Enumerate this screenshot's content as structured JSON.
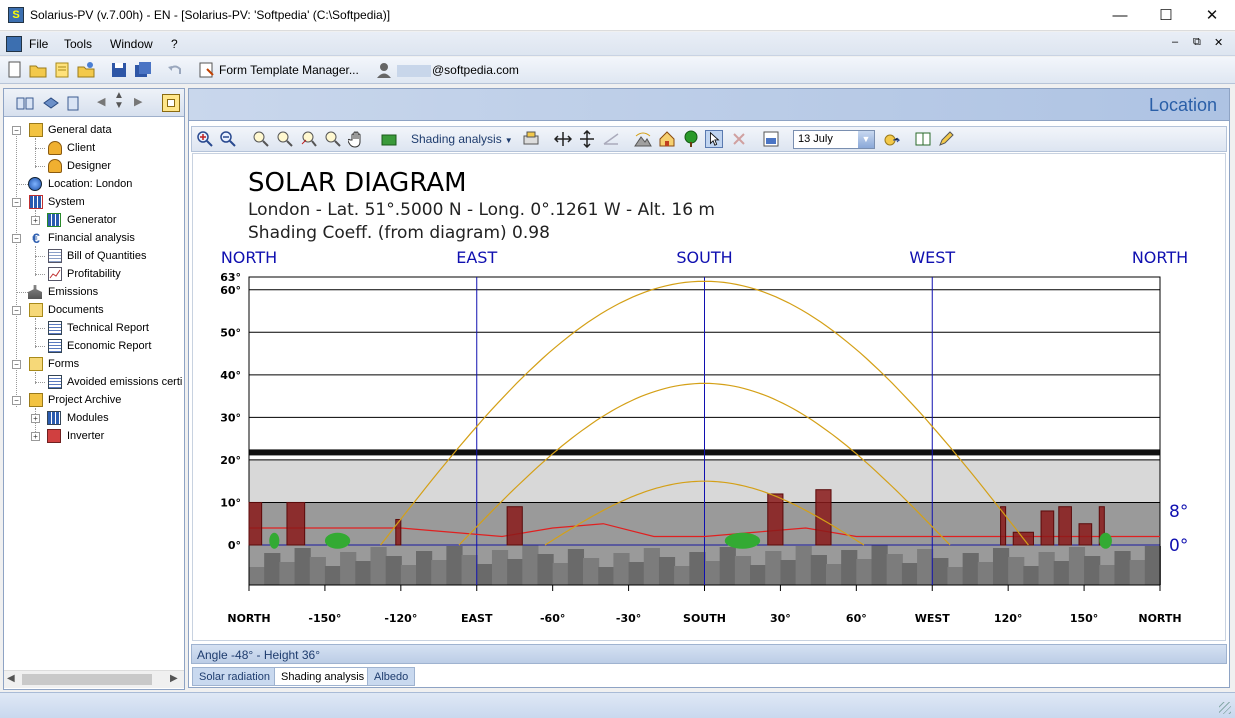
{
  "window": {
    "title": "Solarius-PV (v.7.00h) - EN - [Solarius-PV: 'Softpedia' (C:\\Softpedia)]",
    "minimize": "—",
    "maximize": "☐",
    "close": "✕"
  },
  "menu": {
    "items": [
      "File",
      "Tools",
      "Window",
      "?"
    ],
    "mdi_controls": [
      "–",
      "⧉",
      "✕"
    ]
  },
  "toolbar": {
    "form_template_manager": "Form Template Manager...",
    "user_email": "@softpedia.com"
  },
  "tree": {
    "items": [
      {
        "label": "General data"
      },
      {
        "label": "Client"
      },
      {
        "label": "Designer"
      },
      {
        "label": "Location: London"
      },
      {
        "label": "System"
      },
      {
        "label": "Generator"
      },
      {
        "label": "Financial analysis"
      },
      {
        "label": "Bill of Quantities"
      },
      {
        "label": "Profitability"
      },
      {
        "label": "Emissions"
      },
      {
        "label": "Documents"
      },
      {
        "label": "Technical Report"
      },
      {
        "label": "Economic Report"
      },
      {
        "label": "Forms"
      },
      {
        "label": "Avoided emissions certif"
      },
      {
        "label": "Project Archive"
      },
      {
        "label": "Modules"
      },
      {
        "label": "Inverter"
      }
    ]
  },
  "location_header": "Location",
  "chart_toolbar": {
    "shading_dropdown": "Shading analysis",
    "date": "13 July"
  },
  "chart_data": {
    "type": "line",
    "title": "SOLAR DIAGRAM",
    "subtitle": "London - Lat. 51°.5000 N - Long. 0°.1261 W - Alt. 16 m",
    "shading": "Shading Coeff. (from diagram) 0.98",
    "direction_labels": [
      "NORTH",
      "EAST",
      "SOUTH",
      "WEST",
      "NORTH"
    ],
    "x_ticks": [
      "NORTH",
      "-150°",
      "-120°",
      "EAST",
      "-60°",
      "-30°",
      "SOUTH",
      "30°",
      "60°",
      "WEST",
      "120°",
      "150°",
      "NORTH"
    ],
    "x_tick_values": [
      -180,
      -150,
      -120,
      -90,
      -60,
      -30,
      0,
      30,
      60,
      90,
      120,
      150,
      180
    ],
    "y_ticks": [
      "63°",
      "60°",
      "50°",
      "40°",
      "30°",
      "20°",
      "10°",
      "0°"
    ],
    "y_tick_values": [
      63,
      60,
      50,
      40,
      30,
      20,
      10,
      0
    ],
    "xlim": [
      -180,
      180
    ],
    "ylim": [
      -8,
      63
    ],
    "right_labels": [
      "8°",
      "0°"
    ],
    "series": [
      {
        "peak": 62,
        "rise_azimuth": -128,
        "set_azimuth": 128
      },
      {
        "peak": 38,
        "rise_azimuth": -97,
        "set_azimuth": 97
      },
      {
        "peak": 15,
        "rise_azimuth": -63,
        "set_azimuth": 63
      }
    ],
    "horizon_profile": [
      [
        -180,
        4
      ],
      [
        -150,
        4
      ],
      [
        -120,
        4
      ],
      [
        -100,
        3
      ],
      [
        -80,
        2
      ],
      [
        -60,
        4
      ],
      [
        -40,
        5
      ],
      [
        -20,
        2
      ],
      [
        0,
        2
      ],
      [
        20,
        3
      ],
      [
        40,
        4
      ],
      [
        60,
        2
      ],
      [
        90,
        2
      ],
      [
        120,
        2
      ],
      [
        150,
        2
      ],
      [
        180,
        2
      ]
    ],
    "buildings": [
      [
        -180,
        -175,
        10
      ],
      [
        -165,
        -158,
        10
      ],
      [
        -122,
        -120,
        6
      ],
      [
        -78,
        -72,
        9
      ],
      [
        25,
        31,
        12
      ],
      [
        44,
        50,
        13
      ],
      [
        117,
        119,
        9
      ],
      [
        122,
        130,
        3
      ],
      [
        133,
        138,
        8
      ],
      [
        140,
        145,
        9
      ],
      [
        148,
        153,
        5
      ],
      [
        156,
        158,
        9
      ]
    ],
    "trees": [
      [
        -172,
        -168
      ],
      [
        -150,
        -140
      ],
      [
        8,
        22
      ],
      [
        156,
        161
      ]
    ],
    "colors": {
      "sun_path": "#d4a017",
      "horizon": "#e02020",
      "gridline": "#000000",
      "cardinal": "#1010b0",
      "building": "#8a1a1a",
      "tree": "#33aa33"
    }
  },
  "status": {
    "text": "Angle -48° - Height 36°"
  },
  "tabs": [
    "Solar radiation",
    "Shading analysis",
    "Albedo"
  ]
}
